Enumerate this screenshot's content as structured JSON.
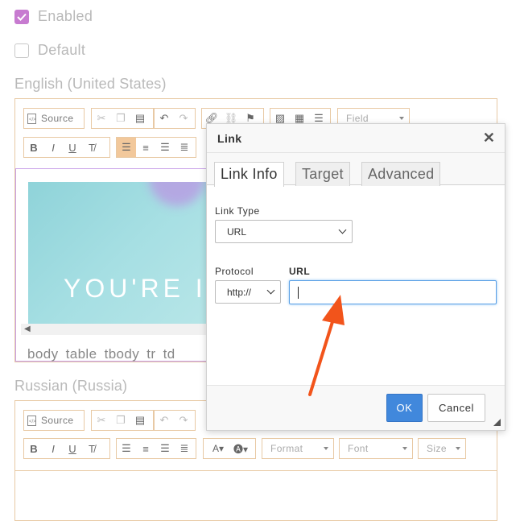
{
  "form": {
    "enabled": {
      "label": "Enabled",
      "checked": true
    },
    "default": {
      "label": "Default",
      "checked": false
    }
  },
  "editors": [
    {
      "language": "English (United States)",
      "toolbar": {
        "source_label": "Source",
        "field_label": "Field"
      },
      "content": {
        "banner_text": "YOU'RE I",
        "element_path": "body table tbody tr td"
      }
    },
    {
      "language": "Russian (Russia)",
      "toolbar": {
        "source_label": "Source",
        "format_label": "Format",
        "font_label": "Font",
        "size_label": "Size"
      }
    }
  ],
  "dialog": {
    "title": "Link",
    "tabs": [
      "Link Info",
      "Target",
      "Advanced"
    ],
    "link_type_label": "Link Type",
    "link_type_value": "URL",
    "protocol_label": "Protocol",
    "protocol_value": "http://",
    "url_label": "URL",
    "url_value": "",
    "ok_label": "OK",
    "cancel_label": "Cancel"
  },
  "colors": {
    "accent_checkbox": "#c77bd0",
    "ok_button": "#4188dc",
    "annotation_arrow": "#f2541b",
    "editor_border": "#e8c9a4"
  },
  "icons": [
    "check-icon",
    "source-icon",
    "cut-icon",
    "copy-icon",
    "paste-icon",
    "undo-icon",
    "redo-icon",
    "link-icon",
    "unlink-icon",
    "flag-icon",
    "image-icon",
    "table-icon",
    "hr-icon",
    "bold-icon",
    "italic-icon",
    "underline-icon",
    "clear-format-icon",
    "align-left-icon",
    "align-center-icon",
    "align-right-icon",
    "justify-icon",
    "text-color-icon",
    "bg-color-icon",
    "close-icon",
    "resize-icon"
  ]
}
